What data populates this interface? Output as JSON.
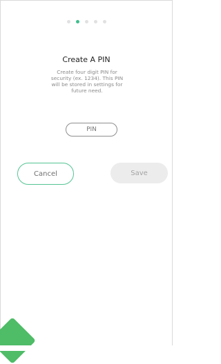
{
  "pager": {
    "steps": 5,
    "active_index": 1
  },
  "content": {
    "title": "Create A PIN",
    "description": "Create four digit PIN for security (ex. 1234). This PIN will be stored in settings for future need.",
    "pin_placeholder": "PIN"
  },
  "buttons": {
    "cancel_label": "Cancel",
    "save_label": "Save"
  },
  "colors": {
    "accent": "#3fbf8d",
    "cancel_border": "#53c493",
    "save_fill": "#ececec",
    "bottom_accent": "#4fbc67"
  }
}
